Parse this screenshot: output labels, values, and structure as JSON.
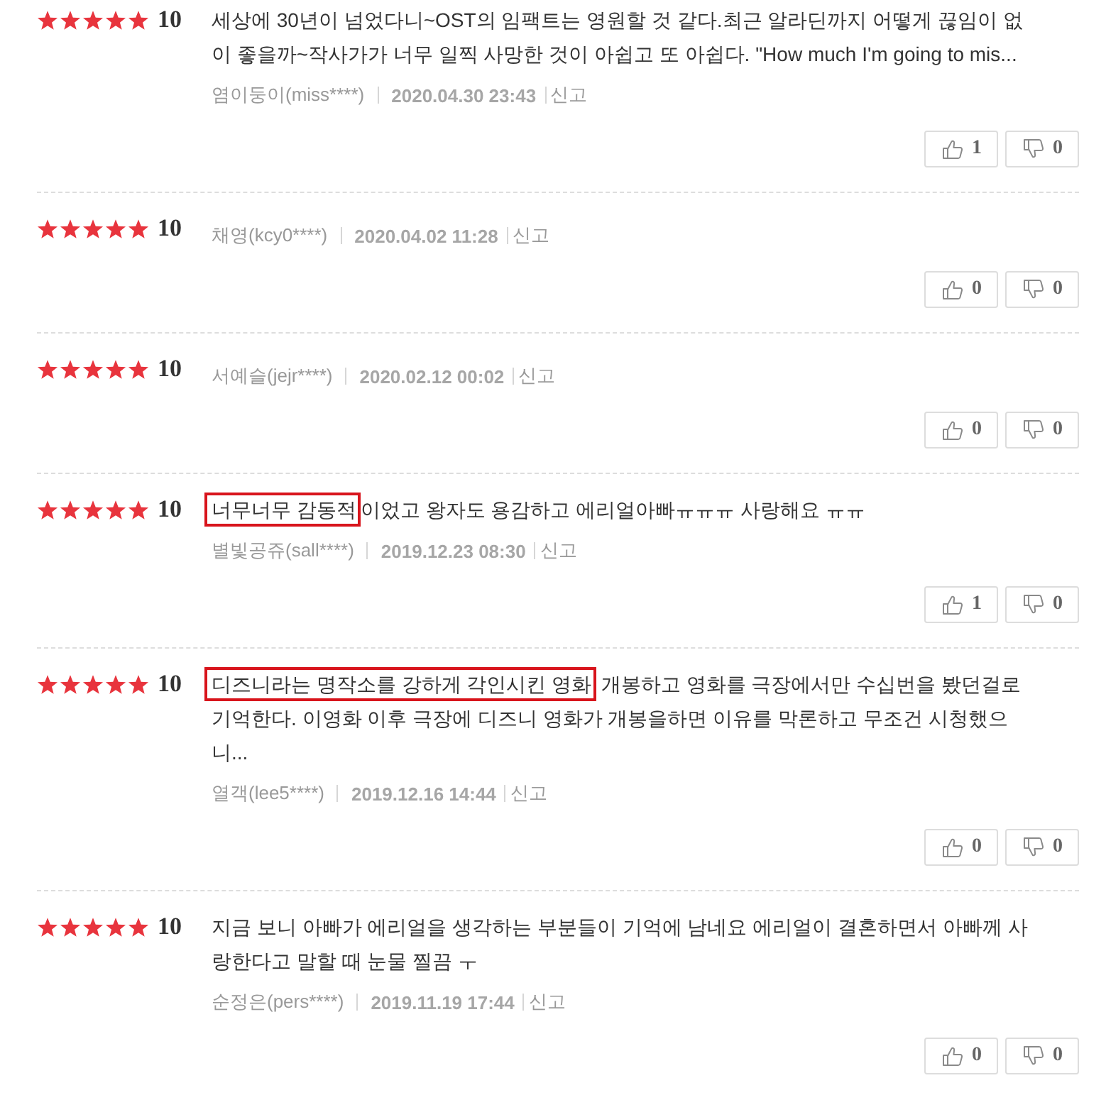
{
  "reviews": [
    {
      "stars": 5,
      "score": "10",
      "text_parts": [
        {
          "text": "세상에 30년이 넘었다니~OST의 임팩트는 영원할 것 같다.최근 알라딘까지 어떻게 끊임이 없이 좋을까~작사가가 너무 일찍 사망한 것이 아쉽고 또 아쉽다. \"How much I'm going to mis...",
          "highlighted": false
        }
      ],
      "author": "염이둥이(miss****)",
      "date": "2020.04.30 23:43",
      "report": "신고",
      "likes": "1",
      "dislikes": "0"
    },
    {
      "stars": 5,
      "score": "10",
      "author": "채영(kcy0****)",
      "date": "2020.04.02 11:28",
      "report": "신고",
      "likes": "0",
      "dislikes": "0"
    },
    {
      "stars": 5,
      "score": "10",
      "author": "서예슬(jejr****)",
      "date": "2020.02.12 00:02",
      "report": "신고",
      "likes": "0",
      "dislikes": "0"
    },
    {
      "stars": 5,
      "score": "10",
      "text_parts": [
        {
          "text": "너무너무 감동적",
          "highlighted": true
        },
        {
          "text": "이었고 왕자도 용감하고 에리얼아빠ㅠㅠㅠ 사랑해요 ㅠㅠ",
          "highlighted": false
        }
      ],
      "author": "별빛공쥬(sall****)",
      "date": "2019.12.23 08:30",
      "report": "신고",
      "likes": "1",
      "dislikes": "0"
    },
    {
      "stars": 5,
      "score": "10",
      "text_parts": [
        {
          "text": "디즈니라는 명작소를 강하게 각인시킨 영화",
          "highlighted": true
        },
        {
          "text": " 개봉하고 영화를 극장에서만 수십번을 봤던걸로 기억한다. 이영화 이후 극장에 디즈니 영화가 개봉을하면 이유를 막론하고 무조건 시청했으니...",
          "highlighted": false
        }
      ],
      "author": "열객(lee5****)",
      "date": "2019.12.16 14:44",
      "report": "신고",
      "likes": "0",
      "dislikes": "0"
    },
    {
      "stars": 5,
      "score": "10",
      "text_parts": [
        {
          "text": "지금 보니 아빠가 에리얼을 생각하는 부분들이 기억에 남네요 에리얼이 결혼하면서 아빠께 사랑한다고 말할 때 눈물 찔끔 ㅜ",
          "highlighted": false
        }
      ],
      "author": "순정은(pers****)",
      "date": "2019.11.19 17:44",
      "report": "신고",
      "likes": "0",
      "dislikes": "0"
    }
  ]
}
